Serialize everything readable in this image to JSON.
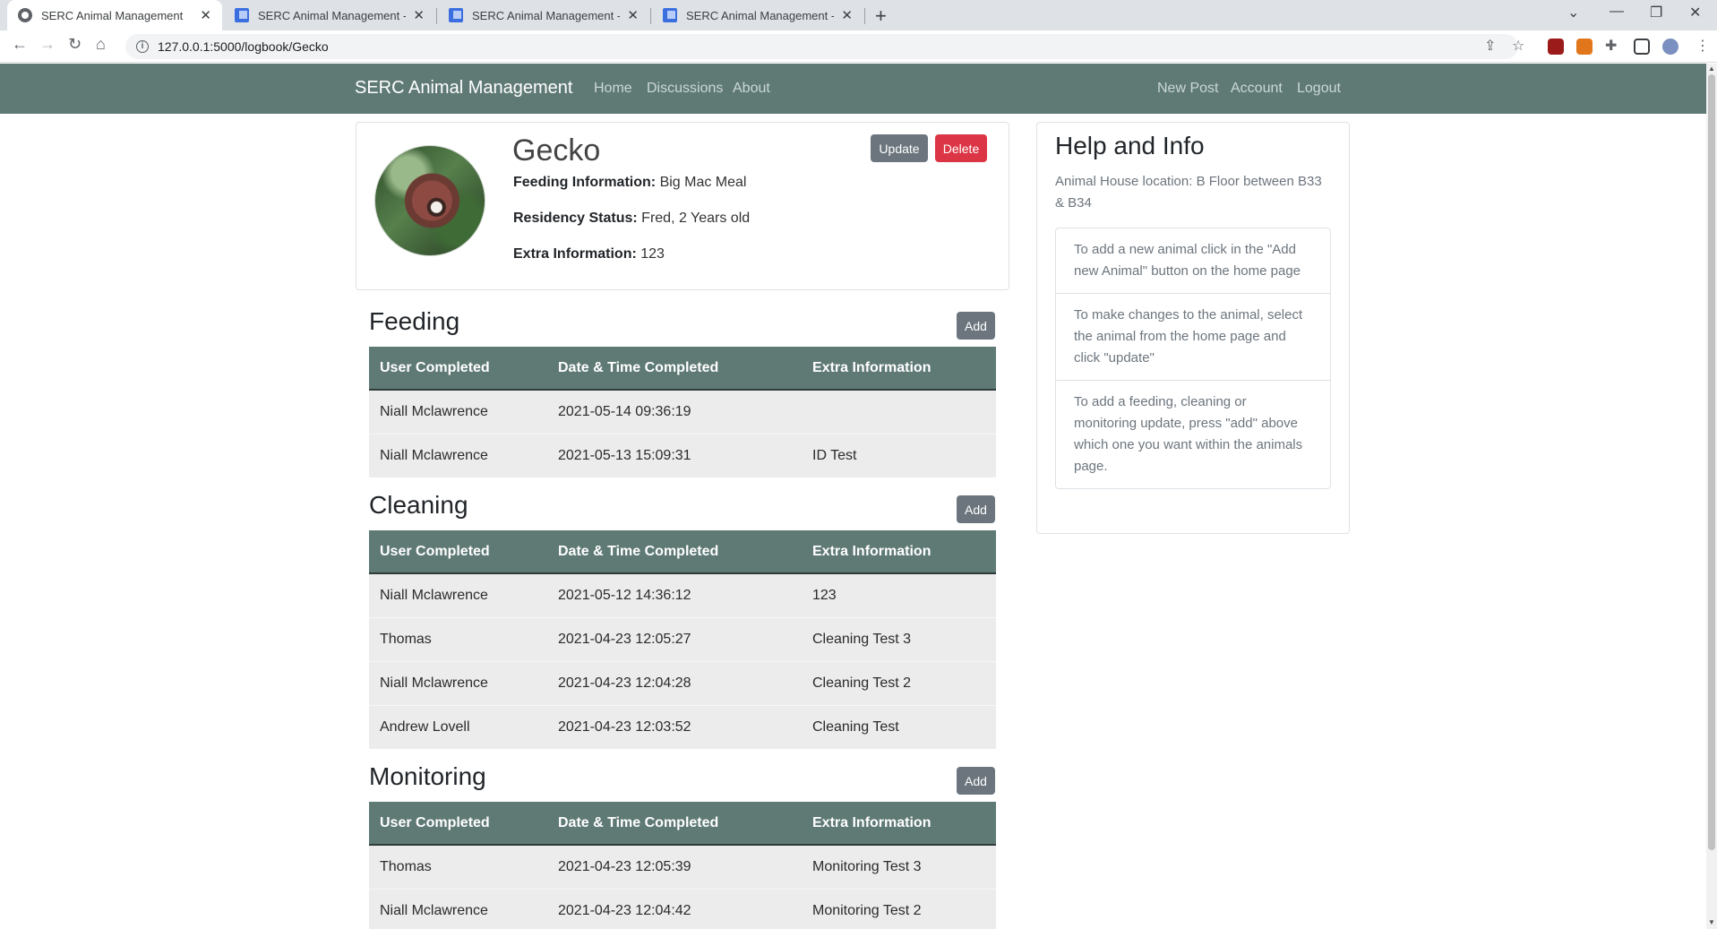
{
  "browser": {
    "tabs": [
      {
        "title": "SERC Animal Management",
        "active": true,
        "icon": "globe-icon"
      },
      {
        "title": "SERC Animal Management - Goo",
        "active": false,
        "icon": "doc-icon"
      },
      {
        "title": "SERC Animal Management - Reg",
        "active": false,
        "icon": "doc-icon"
      },
      {
        "title": "SERC Animal Management - Log",
        "active": false,
        "icon": "doc-icon"
      }
    ],
    "url": "127.0.0.1:5000/logbook/Gecko"
  },
  "navbar": {
    "brand": "SERC Animal Management",
    "left_links": [
      "Home",
      "Discussions",
      "About"
    ],
    "right_links": [
      "New Post",
      "Account",
      "Logout"
    ],
    "color": "#5f7a75"
  },
  "animal": {
    "name": "Gecko",
    "feeding_label": "Feeding Information:",
    "feeding_value": "Big Mac Meal",
    "residency_label": "Residency Status:",
    "residency_value": "Fred, 2 Years old",
    "extra_label": "Extra Information:",
    "extra_value": "123",
    "update_label": "Update",
    "delete_label": "Delete"
  },
  "table_headers": [
    "User Completed",
    "Date & Time Completed",
    "Extra Information"
  ],
  "add_label": "Add",
  "sections": {
    "feeding": {
      "title": "Feeding",
      "rows": [
        [
          "Niall Mclawrence",
          "2021-05-14 09:36:19",
          ""
        ],
        [
          "Niall Mclawrence",
          "2021-05-13 15:09:31",
          "ID Test"
        ]
      ]
    },
    "cleaning": {
      "title": "Cleaning",
      "rows": [
        [
          "Niall Mclawrence",
          "2021-05-12 14:36:12",
          "123"
        ],
        [
          "Thomas",
          "2021-04-23 12:05:27",
          "Cleaning Test 3"
        ],
        [
          "Niall Mclawrence",
          "2021-04-23 12:04:28",
          "Cleaning Test 2"
        ],
        [
          "Andrew Lovell",
          "2021-04-23 12:03:52",
          "Cleaning Test"
        ]
      ]
    },
    "monitoring": {
      "title": "Monitoring",
      "rows": [
        [
          "Thomas",
          "2021-04-23 12:05:39",
          "Monitoring Test 3"
        ],
        [
          "Niall Mclawrence",
          "2021-04-23 12:04:42",
          "Monitoring Test 2"
        ]
      ]
    }
  },
  "help": {
    "title": "Help and Info",
    "subtitle": "Animal House location: B Floor between B33 & B34",
    "items": [
      "To add a new animal click in the \"Add new Animal\" button on the home page",
      "To make changes to the animal, select the animal from the home page and click \"update\"",
      "To add a feeding, cleaning or monitoring update, press \"add\" above which one you want within the animals page."
    ]
  }
}
